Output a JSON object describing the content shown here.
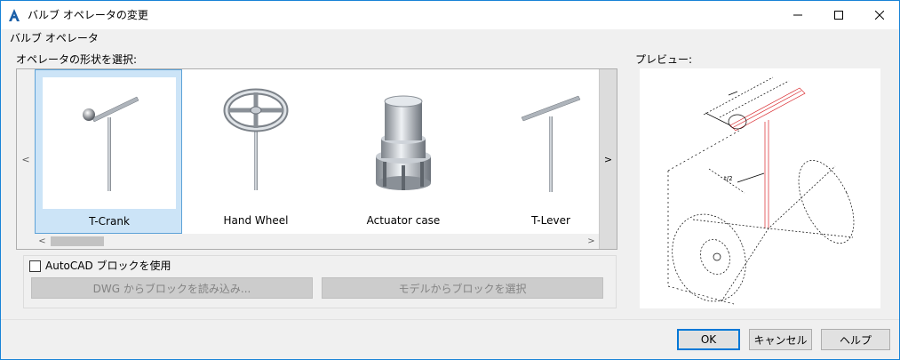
{
  "window": {
    "title": "バルブ オペレータの変更",
    "accent_color": "#1883d7"
  },
  "group": {
    "title": "バルブ オペレータ"
  },
  "shape_select": {
    "label": "オペレータの形状を選択:",
    "nav_prev": "<",
    "nav_next": ">",
    "scroll_left": "<",
    "scroll_right": ">",
    "items": [
      {
        "label": "T-Crank",
        "selected": true,
        "icon": "t-crank-icon"
      },
      {
        "label": "Hand Wheel",
        "selected": false,
        "icon": "hand-wheel-icon"
      },
      {
        "label": "Actuator case",
        "selected": false,
        "icon": "actuator-case-icon"
      },
      {
        "label": "T-Lever",
        "selected": false,
        "icon": "t-lever-icon"
      }
    ]
  },
  "preview": {
    "label": "プレビュー:"
  },
  "block": {
    "checkbox_label": "AutoCAD ブロックを使用",
    "checked": false,
    "load_from_dwg": "DWG からブロックを読み込み...",
    "select_from_model": "モデルからブロックを選択"
  },
  "buttons": {
    "ok": "OK",
    "cancel": "キャンセル",
    "help": "ヘルプ"
  }
}
